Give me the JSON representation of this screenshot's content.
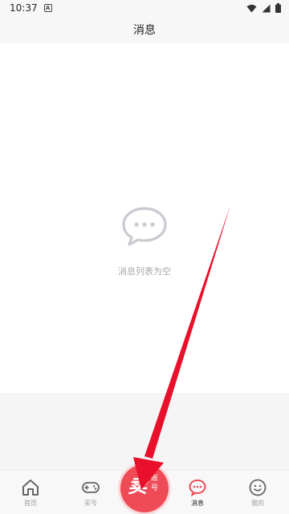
{
  "status_bar": {
    "time": "10:37",
    "notification_letter": "A"
  },
  "header": {
    "title": "消息"
  },
  "empty_state": {
    "icon": "chat-bubble-icon",
    "text": "消息列表为空"
  },
  "tabbar": {
    "tabs": [
      {
        "label": "首页",
        "icon": "home-icon",
        "active": false
      },
      {
        "label": "买号",
        "icon": "gamepad-icon",
        "active": false
      },
      {
        "label": "消息",
        "icon": "message-icon",
        "active": true
      },
      {
        "label": "我的",
        "icon": "smile-icon",
        "active": false
      }
    ],
    "center_button": {
      "big_char": "卖",
      "small_text": "账号"
    }
  },
  "colors": {
    "accent": "#ee4b56",
    "arrow": "#e8102a",
    "inactive": "#9a9a9a"
  }
}
